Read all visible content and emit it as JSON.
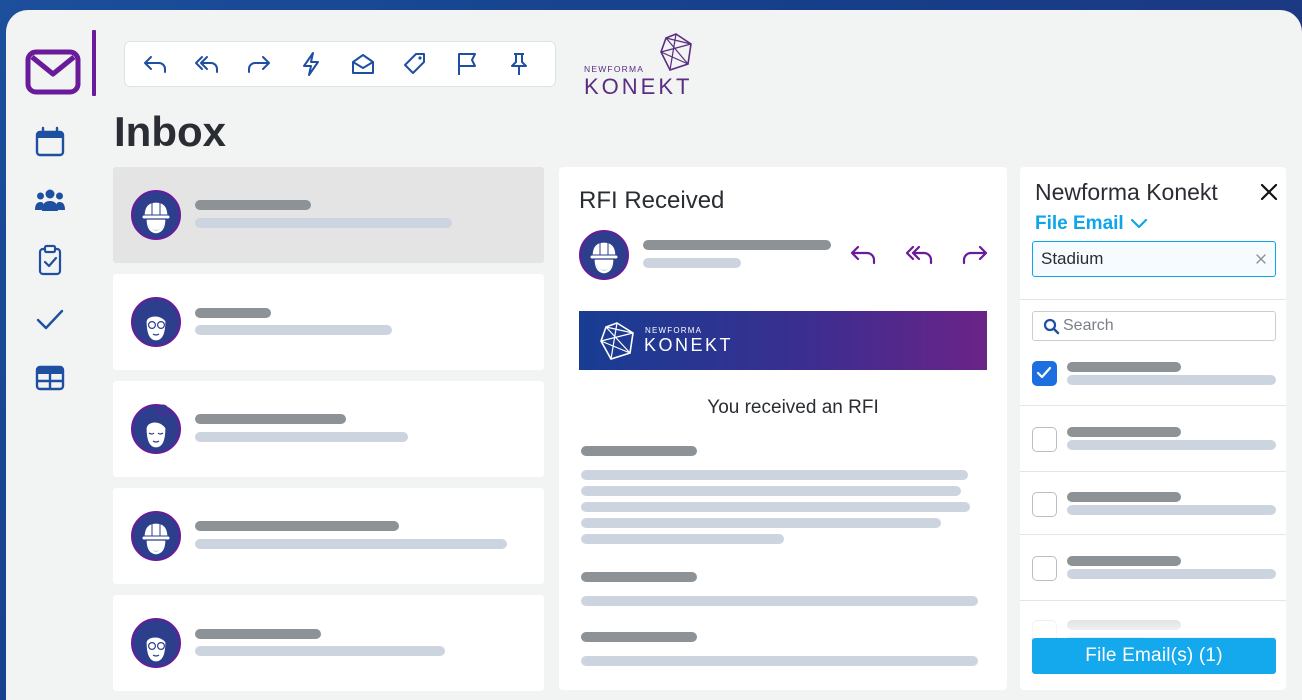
{
  "header": {
    "brand": {
      "small": "NEWFORMA",
      "big": "KONEKT"
    }
  },
  "toolbar": {
    "icons": [
      "reply-icon",
      "reply-all-icon",
      "forward-icon",
      "quick-action-icon",
      "mark-read-icon",
      "tag-icon",
      "flag-icon",
      "pin-icon"
    ]
  },
  "nav": {
    "items": [
      "calendar-icon",
      "people-icon",
      "tasks-icon",
      "checkmark-icon",
      "table-icon"
    ]
  },
  "inbox": {
    "title": "Inbox",
    "messages": [
      {
        "avatar": "hardhat-person",
        "selected": true
      },
      {
        "avatar": "glasses-person",
        "selected": false
      },
      {
        "avatar": "bun-person",
        "selected": false
      },
      {
        "avatar": "hardhat-person",
        "selected": false
      },
      {
        "avatar": "glasses-person",
        "selected": false
      }
    ]
  },
  "reading": {
    "subject": "RFI Received",
    "banner": {
      "small": "NEWFORMA",
      "big": "KONEKT"
    },
    "body_heading": "You received an RFI"
  },
  "addin": {
    "title": "Newforma Konekt",
    "file_email_label": "File Email",
    "project_value": "Stadium",
    "search_placeholder": "Search",
    "folders": [
      {
        "checked": true
      },
      {
        "checked": false
      },
      {
        "checked": false
      },
      {
        "checked": false
      },
      {
        "checked": false
      }
    ],
    "file_button_label": "File Email(s) (1)"
  },
  "colors": {
    "brand_purple": "#6a1b9a",
    "accent_blue": "#0ea5e9",
    "nav_blue": "#1f4fa0",
    "check_blue": "#1d6fe0"
  }
}
